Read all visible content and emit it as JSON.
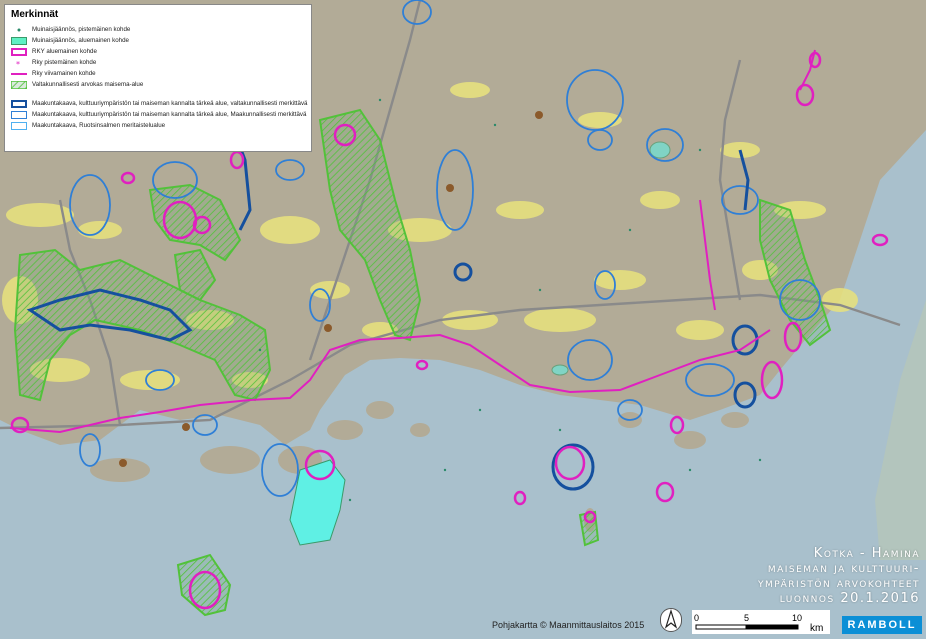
{
  "legend": {
    "title": "Merkinnät",
    "items": [
      {
        "label": "Muinaisjäännös, pistemäinen kohde",
        "icon": "point-symbol-icon"
      },
      {
        "label": "Muinaisjäännös, aluemainen kohde",
        "icon": "green-area-icon"
      },
      {
        "label": "RKY aluemainen kohde",
        "icon": "magenta-area-icon"
      },
      {
        "label": "Rky pistemäinen kohde",
        "icon": "magenta-star-icon"
      },
      {
        "label": "Rky viivamainen kohde",
        "icon": "magenta-line-icon"
      },
      {
        "label": "Valtakunnallisesti arvokas maisema-alue",
        "icon": "green-hatch-icon"
      },
      {
        "label": "Maakuntakaava, kulttuuriympäristön tai maiseman kannalta tärkeä alue, valtakunnallisesti merkittävä",
        "icon": "darkblue-outline-icon"
      },
      {
        "label": "Maakuntakaava, kulttuuriympäristön tai maiseman kannalta tärkeä alue, Maakunnallisesti merkittävä",
        "icon": "blue-outline-icon"
      },
      {
        "label": "Maakuntakaava, Ruotsinsalmen meritaistelualue",
        "icon": "lightblue-outline-icon"
      }
    ]
  },
  "title_lines": [
    "Kotka - Hamina",
    "maiseman ja kulttuuri-",
    "ympäristön arvokohteet",
    "luonnos 20.1.2016"
  ],
  "credit": "Pohjakartta © Maanmittauslaitos 2015",
  "scale": {
    "t0": "0",
    "t5": "5",
    "t10": "10",
    "unit": "km"
  },
  "brand": "RAMBOLL",
  "colors": {
    "land": "#b2ab97",
    "sea": "#a9c0cc",
    "fields": "#e9e37c",
    "rky_magenta": "#e020c0",
    "valtakunnallinen_green": "#52c23a",
    "maakunta_darkblue": "#15509e",
    "maakunta_blue": "#2f7fd6",
    "meritaistelu_cyan": "#5ff0e4",
    "roads": "#8a8a8a"
  }
}
